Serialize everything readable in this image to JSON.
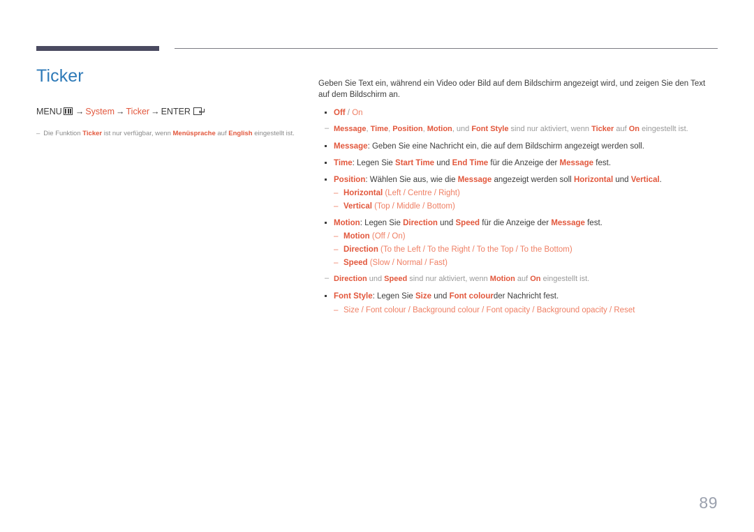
{
  "colors": {
    "title": "#2e7ab8",
    "accent": "#e2573c",
    "accent_light": "#ef7f64",
    "rule_dark": "#4a4a60",
    "rule_thin": "#7b7b83",
    "muted": "#9a9a9a",
    "page_number": "#9aa0ad"
  },
  "header": {
    "title": "Ticker"
  },
  "menu_path": {
    "menu_label": "MENU",
    "menu_icon": "menu-icon",
    "arrow": "→",
    "step_system": "System",
    "step_ticker": "Ticker",
    "enter_label": "ENTER",
    "enter_icon": "enter-key-icon"
  },
  "left_note": {
    "dash": "–",
    "part1": "Die Funktion ",
    "accent1": "Ticker",
    "part2": " ist nur verfügbar, wenn ",
    "accent2": "Menüsprache",
    "part3": " auf ",
    "accent3": "English",
    "part4": " eingestellt ist."
  },
  "main": {
    "intro": "Geben Sie Text ein, während ein Video oder Bild auf dem Bildschirm angezeigt wird, und zeigen Sie den Text auf dem Bildschirm an.",
    "items": [
      {
        "id": "off-on",
        "term": "Off",
        "sep1": " / ",
        "opt": "On"
      },
      {
        "id": "message",
        "term": "Message",
        "rest": ": Geben Sie eine Nachricht ein, die auf dem Bildschirm angezeigt werden soll."
      },
      {
        "id": "time",
        "term": "Time",
        "t1": ": Legen Sie ",
        "a1": "Start Time",
        "t2": " und ",
        "a2": "End Time",
        "t3": " für die Anzeige der ",
        "a3": "Message",
        "t4": " fest."
      },
      {
        "id": "position",
        "term": "Position",
        "t1": ": Wählen Sie aus, wie die ",
        "a1": "Message",
        "t2": " angezeigt werden soll ",
        "a2": "Horizontal",
        "t3": " und ",
        "a3": "Vertical",
        "t4": ".",
        "subs": [
          {
            "dash": "–",
            "term": "Horizontal",
            "options": " (Left / Centre / Right)"
          },
          {
            "dash": "–",
            "term": "Vertical",
            "options": " (Top / Middle / Bottom)"
          }
        ]
      },
      {
        "id": "motion",
        "term": "Motion",
        "t1": ": Legen Sie ",
        "a1": "Direction",
        "t2": " und ",
        "a2": "Speed",
        "t3": " für die Anzeige der ",
        "a3": "Message",
        "t4": " fest.",
        "subs": [
          {
            "dash": "–",
            "term": "Motion",
            "options": " (Off / On)"
          },
          {
            "dash": "–",
            "term": "Direction",
            "options": " (To the Left / To the Right / To the Top / To the Bottom)"
          },
          {
            "dash": "–",
            "term": "Speed",
            "options": " (Slow / Normal / Fast)"
          }
        ]
      },
      {
        "id": "font-style",
        "term": "Font Style",
        "t1": ": Legen Sie ",
        "a1": "Size",
        "t2": " und ",
        "a2": "Font colour",
        "t3": "der Nachricht fest.",
        "subs": [
          {
            "dash": "–",
            "term": "Size / Font colour / Background colour / Font opacity / Background opacity / Reset",
            "options": ""
          }
        ]
      }
    ],
    "note_offon": {
      "dash": "–",
      "a1": "Message",
      "s1": ", ",
      "a2": "Time",
      "s2": ", ",
      "a3": "Position",
      "s3": ", ",
      "a4": "Motion",
      "s4": ", und ",
      "a5": "Font Style",
      "s5": " sind nur aktiviert, wenn ",
      "a6": "Ticker",
      "s6": " auf ",
      "a7": "On",
      "s7": " eingestellt ist."
    },
    "note_motion": {
      "dash": "–",
      "a1": "Direction",
      "s1": " und ",
      "a2": "Speed",
      "s2": " sind nur aktiviert, wenn ",
      "a3": "Motion",
      "s3": " auf ",
      "a4": "On",
      "s4": " eingestellt ist."
    }
  },
  "footer": {
    "page_number": "89"
  }
}
